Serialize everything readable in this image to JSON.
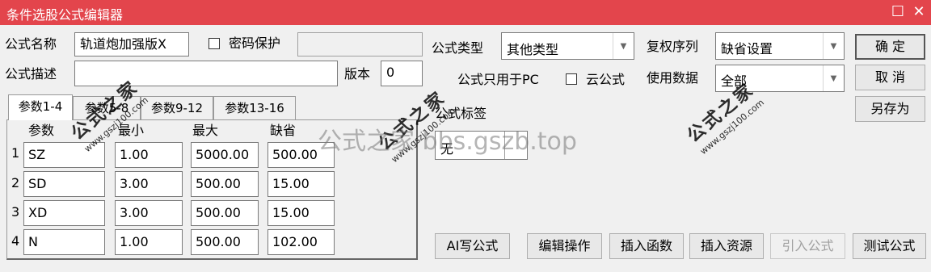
{
  "window": {
    "title": "条件选股公式编辑器",
    "restore_glyph": "☐",
    "close_glyph": "✕",
    "title_bg": "#e3454c"
  },
  "form": {
    "name_label": "公式名称",
    "name_value": "轨道炮加强版X",
    "password_label": "密码保护",
    "password_value": "",
    "desc_label": "公式描述",
    "desc_value": "",
    "version_label": "版本",
    "version_value": "0",
    "type_label": "公式类型",
    "type_value": "其他类型",
    "restore_label": "复权序列",
    "restore_value": "缺省设置",
    "pc_only_label": "公式只用于PC",
    "cloud_label": "云公式",
    "use_data_label": "使用数据",
    "use_data_value": "全部",
    "tags_label": "公式标签",
    "tags_value": "无"
  },
  "params": {
    "tabs": [
      "参数1-4",
      "参数5-8",
      "参数9-12",
      "参数13-16"
    ],
    "headers": [
      "参数",
      "最小",
      "最大",
      "缺省"
    ],
    "rows": [
      {
        "idx": "1",
        "name": "SZ",
        "min": "1.00",
        "max": "5000.00",
        "def": "500.00"
      },
      {
        "idx": "2",
        "name": "SD",
        "min": "3.00",
        "max": "500.00",
        "def": "15.00"
      },
      {
        "idx": "3",
        "name": "XD",
        "min": "3.00",
        "max": "500.00",
        "def": "15.00"
      },
      {
        "idx": "4",
        "name": "N",
        "min": "1.00",
        "max": "500.00",
        "def": "102.00"
      }
    ]
  },
  "buttons": {
    "ok": "确  定",
    "cancel": "取  消",
    "save_as": "另存为",
    "ai_write": "AI写公式",
    "edit_ops": "编辑操作",
    "insert_func": "插入函数",
    "insert_res": "插入资源",
    "import_formula": "引入公式",
    "test_formula": "测试公式"
  },
  "watermarks": {
    "brand": "公式之家",
    "site_small": "www.gszj100.com",
    "site_big": "公式之家 bbs.gszb.top"
  }
}
